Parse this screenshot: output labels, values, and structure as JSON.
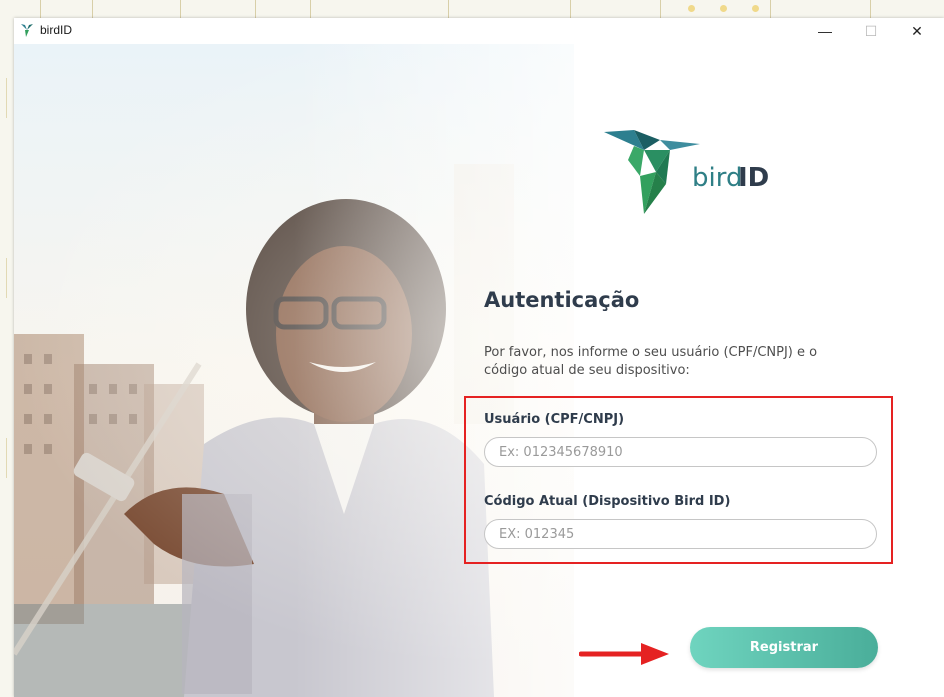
{
  "window": {
    "title": "birdID",
    "controls": {
      "minimize": "—",
      "maximize": "☐",
      "close": "✕"
    }
  },
  "brand": {
    "logo_text_light": "bird",
    "logo_text_bold": "ID",
    "colors": [
      "#1d6d6b",
      "#33a05e",
      "#2d7f8f"
    ]
  },
  "auth": {
    "heading": "Autenticação",
    "description": "Por favor, nos informe o seu usuário (CPF/CNPJ) e o código atual de seu dispositivo:",
    "user_label": "Usuário (CPF/CNPJ)",
    "user_placeholder": "Ex: 012345678910",
    "user_value": "",
    "code_label": "Código Atual (Dispositivo Bird ID)",
    "code_placeholder": "EX: 012345",
    "code_value": "",
    "register_label": "Registrar"
  },
  "annotations": {
    "highlight_color": "#e52222",
    "arrow_color": "#e52222",
    "arrow_icon": "arrow-right-icon"
  },
  "accent_color": "#5cc0aa"
}
